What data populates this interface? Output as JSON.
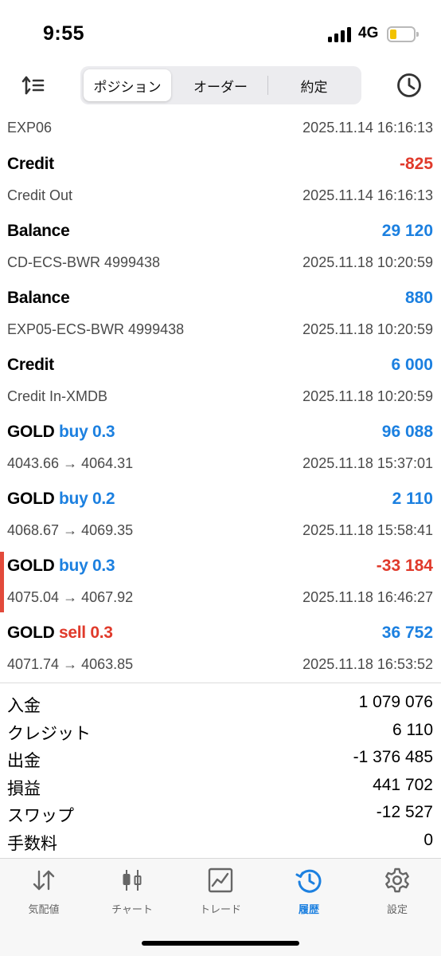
{
  "status": {
    "time": "9:55",
    "network": "4G"
  },
  "toolbar": {
    "segments": [
      {
        "label": "ポジション",
        "active": true
      },
      {
        "label": "オーダー",
        "active": false
      },
      {
        "label": "約定",
        "active": false
      }
    ]
  },
  "history": {
    "first_row": {
      "subtitle": "EXP06",
      "time": "2025.11.14 16:16:13"
    },
    "rows": [
      {
        "title": "Credit",
        "side": "",
        "amount": "-825",
        "amount_color": "red",
        "subtitle": "Credit Out",
        "time": "2025.11.14 16:16:13"
      },
      {
        "title": "Balance",
        "side": "",
        "amount": "29 120",
        "amount_color": "blue",
        "subtitle": "CD-ECS-BWR 4999438",
        "time": "2025.11.18 10:20:59"
      },
      {
        "title": "Balance",
        "side": "",
        "amount": "880",
        "amount_color": "blue",
        "subtitle": "EXP05-ECS-BWR 4999438",
        "time": "2025.11.18 10:20:59"
      },
      {
        "title": "Credit",
        "side": "",
        "amount": "6 000",
        "amount_color": "blue",
        "subtitle": "Credit In-XMDB",
        "time": "2025.11.18 10:20:59"
      },
      {
        "title": "GOLD",
        "side": "buy 0.3",
        "side_color": "blue",
        "amount": "96 088",
        "amount_color": "blue",
        "subtitle": "4043.66 → 4064.31",
        "time": "2025.11.18 15:37:01"
      },
      {
        "title": "GOLD",
        "side": "buy 0.2",
        "side_color": "blue",
        "amount": "2 110",
        "amount_color": "blue",
        "subtitle": "4068.67 → 4069.35",
        "time": "2025.11.18 15:58:41"
      },
      {
        "title": "GOLD",
        "side": "buy 0.3",
        "side_color": "blue",
        "amount": "-33 184",
        "amount_color": "red",
        "subtitle": "4075.04 → 4067.92",
        "time": "2025.11.18 16:46:27",
        "marked": true
      },
      {
        "title": "GOLD",
        "side": "sell 0.3",
        "side_color": "red",
        "amount": "36 752",
        "amount_color": "blue",
        "subtitle": "4071.74 → 4063.85",
        "time": "2025.11.18 16:53:52"
      }
    ]
  },
  "summary": [
    {
      "label": "入金",
      "value": "1 079 076"
    },
    {
      "label": "クレジット",
      "value": "6 110"
    },
    {
      "label": "出金",
      "value": "-1 376 485"
    },
    {
      "label": "損益",
      "value": "441 702"
    },
    {
      "label": "スワップ",
      "value": "-12 527"
    },
    {
      "label": "手数料",
      "value": "0"
    }
  ],
  "tabbar": [
    {
      "label": "気配値",
      "icon": "quotes-arrows-icon",
      "active": false
    },
    {
      "label": "チャート",
      "icon": "candlestick-chart-icon",
      "active": false
    },
    {
      "label": "トレード",
      "icon": "trade-line-chart-icon",
      "active": false
    },
    {
      "label": "履歴",
      "icon": "history-clock-icon",
      "active": true
    },
    {
      "label": "設定",
      "icon": "gear-icon",
      "active": false
    }
  ],
  "colors": {
    "blue": "#1c80e0",
    "red": "#e03a2b",
    "marker": "#e24a3b"
  }
}
